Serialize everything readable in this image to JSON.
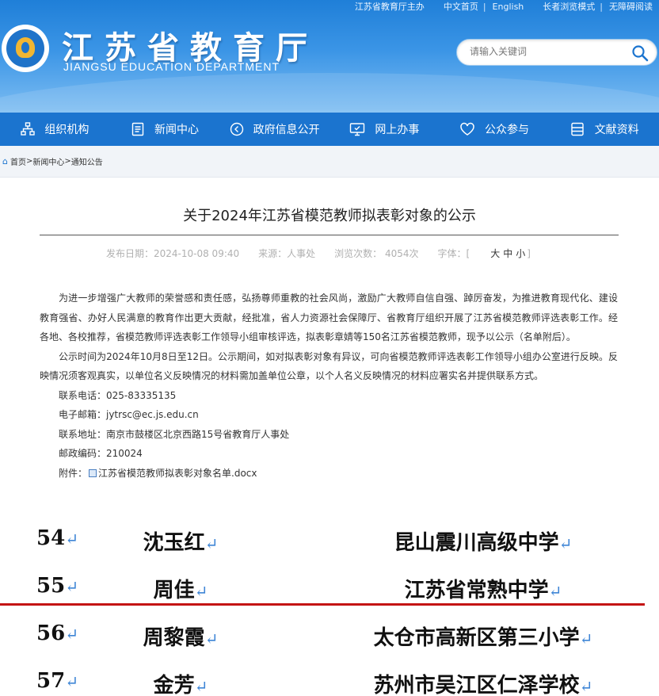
{
  "header": {
    "toplinks": {
      "host": "江苏省教育厅主办",
      "chinese": "中文首页",
      "english": "English",
      "elder": "长者浏览模式",
      "accessible": "无障碍阅读"
    },
    "title": "江苏省教育厅",
    "subtitle": "JIANGSU EDUCATION DEPARTMENT",
    "search_placeholder": "请输入关键词"
  },
  "nav": [
    {
      "label": "组织机构",
      "icon": "org-chart-icon"
    },
    {
      "label": "新闻中心",
      "icon": "news-icon"
    },
    {
      "label": "政府信息公开",
      "icon": "info-disclosure-icon"
    },
    {
      "label": "网上办事",
      "icon": "online-service-icon"
    },
    {
      "label": "公众参与",
      "icon": "heart-icon"
    },
    {
      "label": "文献资料",
      "icon": "documents-icon"
    }
  ],
  "breadcrumb": {
    "home": "首页",
    "news": "新闻中心",
    "notice": "通知公告"
  },
  "article": {
    "title": "关于2024年江苏省模范教师拟表彰对象的公示",
    "meta": {
      "date": "发布日期：2024-10-08 09:40",
      "source": "来源：人事处",
      "views": "浏览次数： 4054次",
      "font_label": "字体：[",
      "font_large": "大",
      "font_mid": "中",
      "font_small": "小",
      "font_end": "]"
    },
    "para1": "为进一步增强广大教师的荣誉感和责任感，弘扬尊师重教的社会风尚，激励广大教师自信自强、踔厉奋发，为推进教育现代化、建设教育强省、办好人民满意的教育作出更大贡献，经批准，省人力资源社会保障厅、省教育厅组织开展了江苏省模范教师评选表彰工作。经各地、各校推荐，省模范教师评选表彰工作领导小组审核评选，拟表彰章婧等150名江苏省模范教师，现予以公示（名单附后）。",
    "para2": "公示时间为2024年10月8日至12日。公示期间，如对拟表彰对象有异议，可向省模范教师评选表彰工作领导小组办公室进行反映。反映情况须客观真实，以单位名义反映情况的材料需加盖单位公章，以个人名义反映情况的材料应署实名并提供联系方式。",
    "phone": "联系电话：025-83335135",
    "email": "电子邮箱：jytrsc@ec.js.edu.cn",
    "address": "联系地址：南京市鼓楼区北京西路15号省教育厅人事处",
    "postcode": "邮政编码：210024",
    "attach_label": "附件：",
    "attach_file": "江苏省模范教师拟表彰对象名单.docx"
  },
  "table": [
    {
      "num": "54",
      "name": "沈玉红",
      "school": "昆山震川高级中学"
    },
    {
      "num": "55",
      "name": "周佳",
      "school": "江苏省常熟中学"
    },
    {
      "num": "56",
      "name": "周黎霞",
      "school": "太仓市高新区第三小学"
    },
    {
      "num": "57",
      "name": "金芳",
      "school": "苏州市吴江区仁泽学校"
    }
  ],
  "return_mark": "↵",
  "colors": {
    "nav_bg": "#1b74cf",
    "highlight_rule": "#c41414"
  }
}
